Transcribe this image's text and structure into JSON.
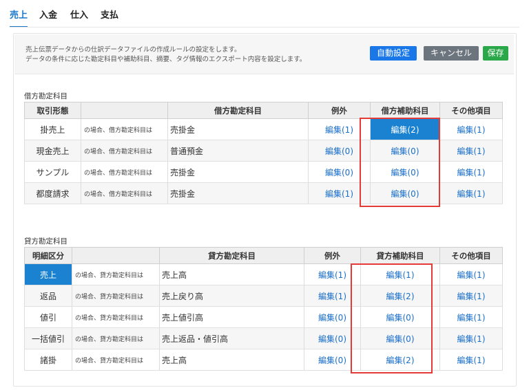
{
  "tabs": [
    {
      "label": "売上",
      "active": true
    },
    {
      "label": "入金",
      "active": false
    },
    {
      "label": "仕入",
      "active": false
    },
    {
      "label": "支払",
      "active": false
    }
  ],
  "description": {
    "line1": "売上伝票データからの仕訳データファイルの作成ルールの設定をします。",
    "line2": "データの条件に応じた勘定科目や補助科目、摘要、タグ情報のエクスポート内容を設定します。"
  },
  "buttons": {
    "auto": "自動設定",
    "cancel": "キャンセル",
    "save": "保存"
  },
  "debit": {
    "section_title": "借方勘定科目",
    "headers": [
      "取引形態",
      "",
      "借方勘定科目",
      "例外",
      "借方補助科目",
      "その他項目"
    ],
    "rows": [
      {
        "type": "掛売上",
        "condition": "の場合、借方勘定科目は",
        "account": "売掛金",
        "exception": "編集(1)",
        "sub": "編集(2)",
        "other": "編集(1)"
      },
      {
        "type": "現金売上",
        "condition": "の場合、借方勘定科目は",
        "account": "普通預金",
        "exception": "編集(0)",
        "sub": "編集(0)",
        "other": "編集(1)"
      },
      {
        "type": "サンプル",
        "condition": "の場合、借方勘定科目は",
        "account": "売掛金",
        "exception": "編集(0)",
        "sub": "編集(0)",
        "other": "編集(1)"
      },
      {
        "type": "都度請求",
        "condition": "の場合、借方勘定科目は",
        "account": "売掛金",
        "exception": "編集(1)",
        "sub": "編集(0)",
        "other": "編集(1)"
      }
    ]
  },
  "credit": {
    "section_title": "貸方勘定科目",
    "headers": [
      "明細区分",
      "",
      "貸方勘定科目",
      "例外",
      "貸方補助科目",
      "その他項目"
    ],
    "rows": [
      {
        "type": "売上",
        "condition": "の場合、貸方勘定科目は",
        "account": "売上高",
        "exception": "編集(1)",
        "sub": "編集(1)",
        "other": "編集(1)"
      },
      {
        "type": "返品",
        "condition": "の場合、貸方勘定科目は",
        "account": "売上戻り高",
        "exception": "編集(1)",
        "sub": "編集(2)",
        "other": "編集(1)"
      },
      {
        "type": "値引",
        "condition": "の場合、貸方勘定科目は",
        "account": "売上値引高",
        "exception": "編集(0)",
        "sub": "編集(0)",
        "other": "編集(1)"
      },
      {
        "type": "一括値引",
        "condition": "の場合、貸方勘定科目は",
        "account": "売上返品・値引高",
        "exception": "編集(0)",
        "sub": "編集(0)",
        "other": "編集(1)"
      },
      {
        "type": "諸掛",
        "condition": "の場合、貸方勘定科目は",
        "account": "売上高",
        "exception": "編集(0)",
        "sub": "編集(2)",
        "other": "編集(1)"
      }
    ]
  },
  "colors": {
    "accent": "#1a77c9",
    "selected_cell": "#1a82d1",
    "auto_button": "#1a77e8",
    "cancel_button": "#6c757d",
    "save_button": "#2aa849",
    "highlight": "#e53935"
  }
}
